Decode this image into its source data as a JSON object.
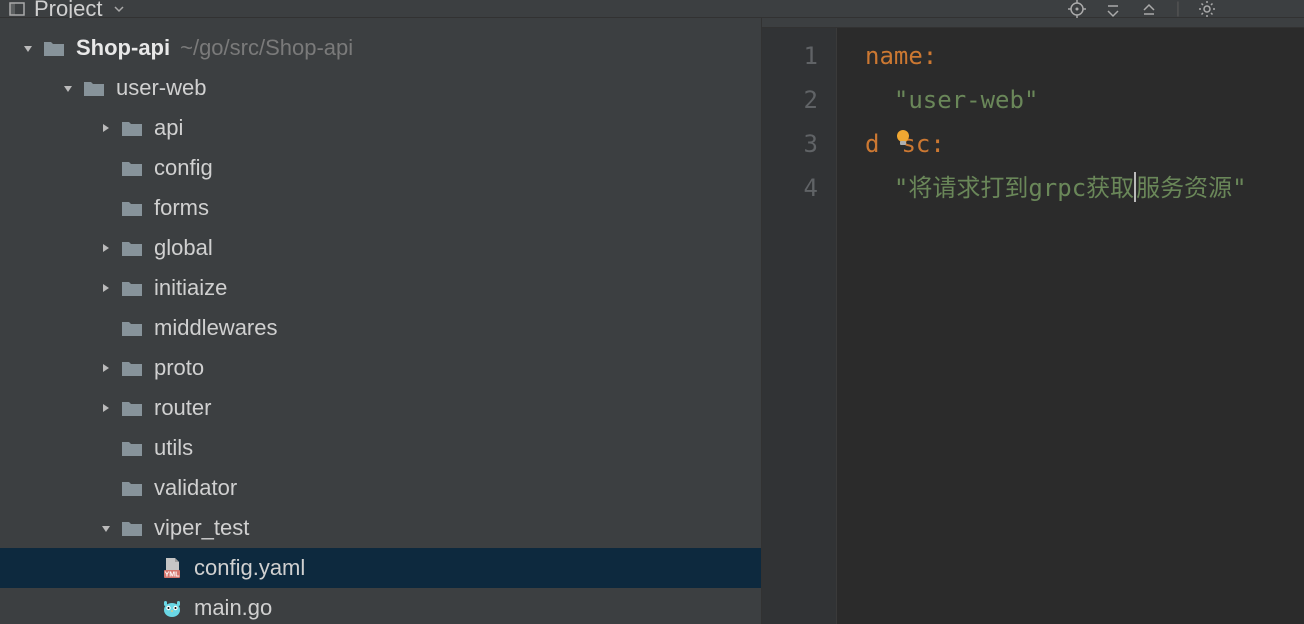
{
  "toolbar": {
    "panel_title": "Project"
  },
  "tree": {
    "root_name": "Shop-api",
    "root_path": "~/go/src/Shop-api",
    "user_web": "user-web",
    "api": "api",
    "config": "config",
    "forms": "forms",
    "global": "global",
    "initiaize": "initiaize",
    "middlewares": "middlewares",
    "proto": "proto",
    "router": "router",
    "utils": "utils",
    "validator": "validator",
    "viper_test": "viper_test",
    "config_yaml": "config.yaml",
    "main_go": "main.go"
  },
  "editor": {
    "lines": [
      "1",
      "2",
      "3",
      "4"
    ],
    "key_name": "name",
    "val_name": "\"user-web\"",
    "key_desc_d": "d",
    "key_desc_sc": "sc",
    "val_desc_prefix": "\"将请求打到grpc获取",
    "val_desc_suffix": "服务资源\""
  }
}
